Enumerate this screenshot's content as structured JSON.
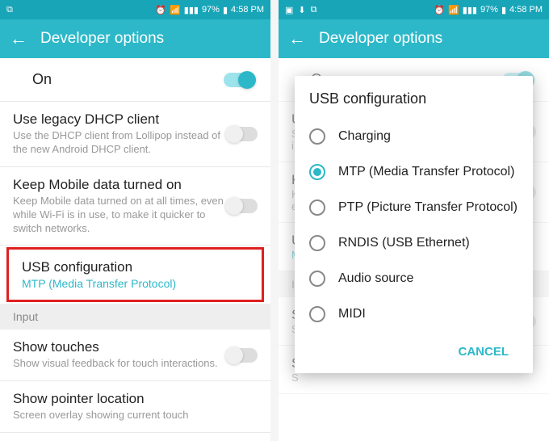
{
  "status": {
    "battery_pct": "97%",
    "time": "4:58 PM"
  },
  "header": {
    "title": "Developer options"
  },
  "on_row": {
    "label": "On"
  },
  "left": {
    "items": [
      {
        "title": "Use legacy DHCP client",
        "desc": "Use the DHCP client from Lollipop instead of the new Android DHCP client."
      },
      {
        "title": "Keep Mobile data turned on",
        "desc": "Keep Mobile data turned on at all times, even while Wi-Fi is in use, to make it quicker to switch networks."
      },
      {
        "title": "USB configuration",
        "value": "MTP (Media Transfer Protocol)"
      }
    ],
    "section_input": "Input",
    "items2": [
      {
        "title": "Show touches",
        "desc": "Show visual feedback for touch interactions."
      },
      {
        "title": "Show pointer location",
        "desc": "Screen overlay showing current touch"
      }
    ]
  },
  "right": {
    "peek": {
      "t1": "US",
      "d1": "S",
      "d1b": "i",
      "t2": "K",
      "d2": "K",
      "d2b": "e",
      "t3": "U",
      "d3": "M",
      "sec": "In",
      "t4": "S",
      "d4": "S",
      "t5": "S",
      "d5": "S"
    }
  },
  "dialog": {
    "title": "USB configuration",
    "options": [
      {
        "label": "Charging",
        "selected": false
      },
      {
        "label": "MTP (Media Transfer Protocol)",
        "selected": true
      },
      {
        "label": "PTP (Picture Transfer Protocol)",
        "selected": false
      },
      {
        "label": "RNDIS (USB Ethernet)",
        "selected": false
      },
      {
        "label": "Audio source",
        "selected": false
      },
      {
        "label": "MIDI",
        "selected": false
      }
    ],
    "cancel": "CANCEL"
  }
}
